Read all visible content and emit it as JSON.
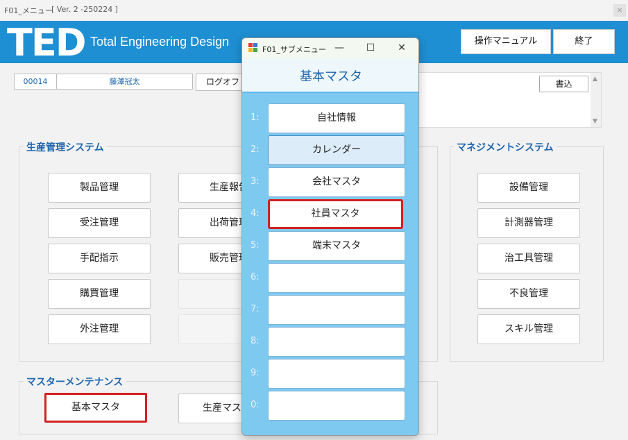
{
  "window": {
    "title": "F01_メニュー",
    "version": "[ Ver. 2 -250224 ]",
    "close_glyph": "×"
  },
  "header": {
    "logo": "TED",
    "tagline": "Total Engineering Design",
    "manual_label": "操作マニュアル",
    "exit_label": "終了",
    "brand_color": "#1e8fd2"
  },
  "user": {
    "id": "00014",
    "name": "藤澤冠太",
    "logout_label": "ログオフ"
  },
  "notes": {
    "write_label": "書込"
  },
  "production": {
    "title": "生産管理システム",
    "col1": [
      "製品管理",
      "受注管理",
      "手配指示",
      "購買管理",
      "外注管理"
    ],
    "col2": [
      "生産報告",
      "出荷管理",
      "販売管理"
    ]
  },
  "management": {
    "title": "マネジメントシステム",
    "items": [
      "設備管理",
      "計測器管理",
      "治工具管理",
      "不良管理",
      "スキル管理"
    ]
  },
  "maintenance": {
    "title": "マスターメンテナンス",
    "items": [
      "基本マスタ",
      "生産マスタ"
    ]
  },
  "submenu": {
    "title": "F01_サブメニュー",
    "header": "基本マスタ",
    "controls": {
      "minimize": "—",
      "maximize": "☐",
      "close": "✕"
    },
    "rows": [
      {
        "num": "1:",
        "label": "自社情報"
      },
      {
        "num": "2:",
        "label": "カレンダー"
      },
      {
        "num": "3:",
        "label": "会社マスタ"
      },
      {
        "num": "4:",
        "label": "社員マスタ"
      },
      {
        "num": "5:",
        "label": "端末マスタ"
      },
      {
        "num": "6:",
        "label": ""
      },
      {
        "num": "7:",
        "label": ""
      },
      {
        "num": "8:",
        "label": ""
      },
      {
        "num": "9:",
        "label": ""
      },
      {
        "num": "0:",
        "label": ""
      }
    ]
  },
  "colors": {
    "accent": "#1d64ae",
    "highlight": "#d42020",
    "submenu_bg": "#7ec9f0"
  }
}
